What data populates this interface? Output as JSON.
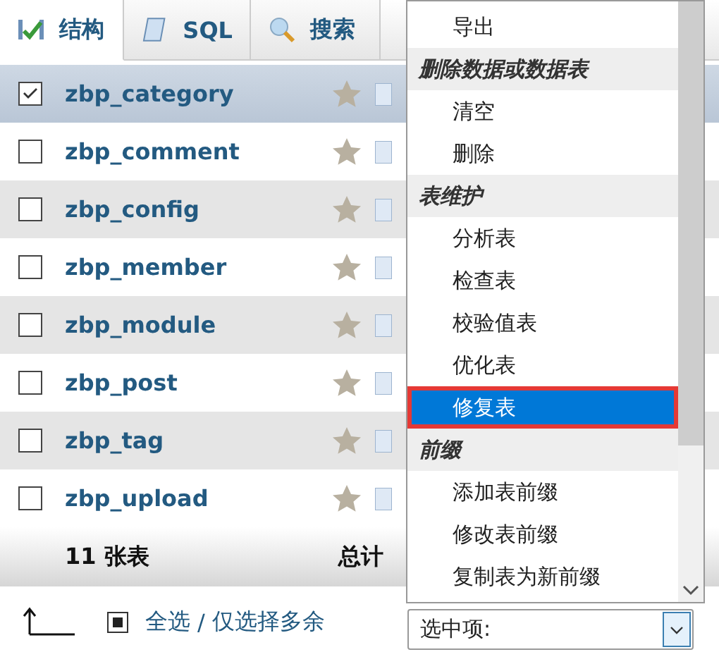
{
  "tabs": [
    {
      "label": "结构",
      "selected": true
    },
    {
      "label": "SQL",
      "selected": false
    },
    {
      "label": "搜索",
      "selected": false
    }
  ],
  "tables": [
    {
      "name": "zbp_category",
      "checked": true
    },
    {
      "name": "zbp_comment",
      "checked": false
    },
    {
      "name": "zbp_config",
      "checked": false
    },
    {
      "name": "zbp_member",
      "checked": false
    },
    {
      "name": "zbp_module",
      "checked": false
    },
    {
      "name": "zbp_post",
      "checked": false
    },
    {
      "name": "zbp_tag",
      "checked": false
    },
    {
      "name": "zbp_upload",
      "checked": false
    }
  ],
  "footer": {
    "count": "11 张表",
    "total": "总计"
  },
  "bulk": {
    "select_all": "全选",
    "separator": "/",
    "select_overhead": "仅选择多余"
  },
  "action_menu": {
    "items": [
      {
        "kind": "option",
        "label": "导出",
        "selected": false
      },
      {
        "kind": "group",
        "label": "删除数据或数据表"
      },
      {
        "kind": "option",
        "label": "清空",
        "selected": false
      },
      {
        "kind": "option",
        "label": "删除",
        "selected": false
      },
      {
        "kind": "group",
        "label": "表维护"
      },
      {
        "kind": "option",
        "label": "分析表",
        "selected": false
      },
      {
        "kind": "option",
        "label": "检查表",
        "selected": false
      },
      {
        "kind": "option",
        "label": "校验值表",
        "selected": false
      },
      {
        "kind": "option",
        "label": "优化表",
        "selected": false
      },
      {
        "kind": "option",
        "label": "修复表",
        "selected": true
      },
      {
        "kind": "group",
        "label": "前缀"
      },
      {
        "kind": "option",
        "label": "添加表前缀",
        "selected": false
      },
      {
        "kind": "option",
        "label": "修改表前缀",
        "selected": false
      },
      {
        "kind": "option",
        "label": "复制表为新前缀",
        "selected": false
      }
    ]
  },
  "action_select": {
    "value": "选中项:"
  }
}
